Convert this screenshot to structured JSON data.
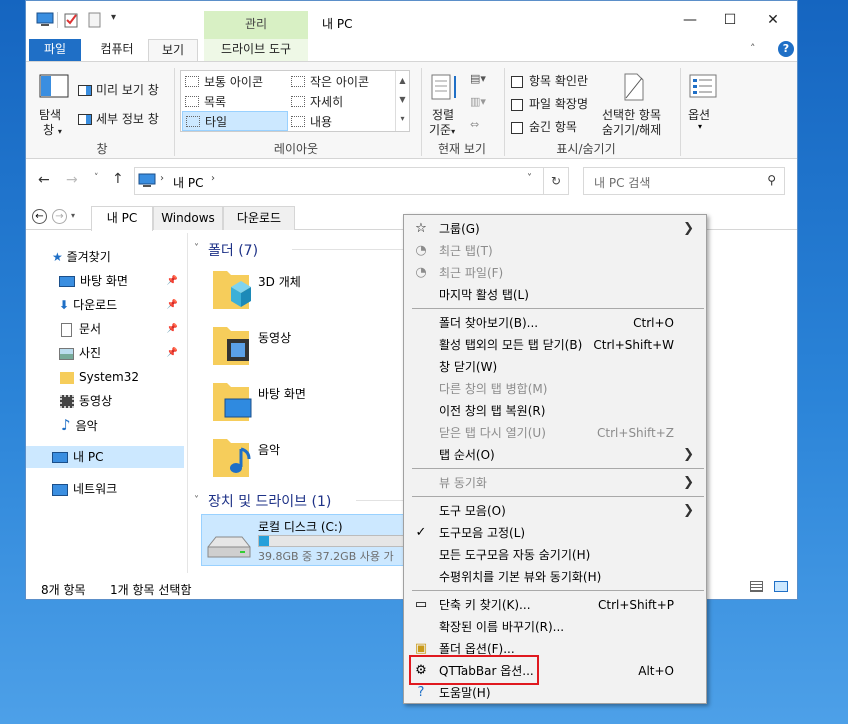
{
  "window": {
    "title": "내 PC",
    "context_tab_label": "관리",
    "controls": {
      "minimize": "—",
      "maximize": "☐",
      "close": "✕"
    }
  },
  "ribbon_tabs": {
    "file": "파일",
    "computer": "컴퓨터",
    "view": "보기",
    "drive_tools": "드라이브 도구"
  },
  "ribbon": {
    "nav_pane_line1": "탐색",
    "nav_pane_line2": "창",
    "preview_pane": "미리 보기 창",
    "details_pane": "세부 정보 창",
    "panes_group": "창",
    "layout_items": {
      "normal_icons": "보통 아이콘",
      "small_icons": "작은 아이콘",
      "list": "목록",
      "details": "자세히",
      "tiles": "타일",
      "content": "내용"
    },
    "layout_group": "레이아웃",
    "sort_line1": "정렬",
    "sort_line2": "기준",
    "current_view_group": "현재 보기",
    "item_checkboxes": "항목 확인란",
    "file_extensions": "파일 확장명",
    "hidden_items": "숨긴 항목",
    "hide_selected_line1": "선택한 항목",
    "hide_selected_line2": "숨기기/해제",
    "showhide_group": "표시/숨기기",
    "options": "옵션"
  },
  "address": {
    "path": "내 PC",
    "search_placeholder": "내 PC 검색"
  },
  "qt_tabs": [
    "내 PC",
    "Windows",
    "다운로드"
  ],
  "nav": {
    "quick_access": "즐겨찾기",
    "desktop": "바탕 화면",
    "downloads": "다운로드",
    "documents": "문서",
    "pictures": "사진",
    "system32": "System32",
    "videos": "동영상",
    "music": "음악",
    "this_pc": "내 PC",
    "network": "네트워크"
  },
  "content": {
    "folders_group": "폴더 (7)",
    "folders": [
      "3D 개체",
      "동영상",
      "바탕 화면",
      "음악"
    ],
    "drives_group": "장치 및 드라이브 (1)",
    "drive_name": "로컬 디스크 (C:)",
    "drive_space": "39.8GB 중 37.2GB 사용 가",
    "drive_used_fraction": 0.065
  },
  "status": {
    "count": "8개 항목",
    "selected": "1개 항목 선택함"
  },
  "context_menu": {
    "items": [
      {
        "label": "그룹(G)",
        "submenu": true
      },
      {
        "label": "최근 탭(T)",
        "disabled": true
      },
      {
        "label": "최근 파일(F)",
        "disabled": true
      },
      {
        "label": "마지막 활성 탭(L)"
      },
      {
        "label": "폴더 찾아보기(B)...",
        "shortcut": "Ctrl+O"
      },
      {
        "label": "활성 탭외의 모든 탭 닫기(B)",
        "shortcut": "Ctrl+Shift+W"
      },
      {
        "label": "창 닫기(W)"
      },
      {
        "label": "다른 창의 탭 병합(M)",
        "disabled": true
      },
      {
        "label": "이전 창의 탭 복원(R)"
      },
      {
        "label": "닫은 탭 다시 열기(U)",
        "shortcut": "Ctrl+Shift+Z",
        "disabled": true
      },
      {
        "label": "탭 순서(O)",
        "submenu": true
      },
      {
        "label": "뷰 동기화",
        "submenu": true,
        "disabled": true
      },
      {
        "label": "도구 모음(O)",
        "submenu": true
      },
      {
        "label": "도구모음 고정(L)",
        "checked": true
      },
      {
        "label": "모든 도구모음 자동 숨기기(H)"
      },
      {
        "label": "수평위치를 기본 뷰와 동기화(H)"
      },
      {
        "label": "단축 키 찾기(K)...",
        "shortcut": "Ctrl+Shift+P"
      },
      {
        "label": "확장된 이름 바꾸기(R)..."
      },
      {
        "label": "폴더 옵션(F)..."
      },
      {
        "label": "QTTabBar 옵션...",
        "shortcut": "Alt+O"
      },
      {
        "label": "도움말(H)"
      }
    ]
  },
  "colors": {
    "accent": "#1f6fc6",
    "selection": "#cce8ff",
    "highlight_box": "#e0191f",
    "folder": "#f6cd5b"
  }
}
